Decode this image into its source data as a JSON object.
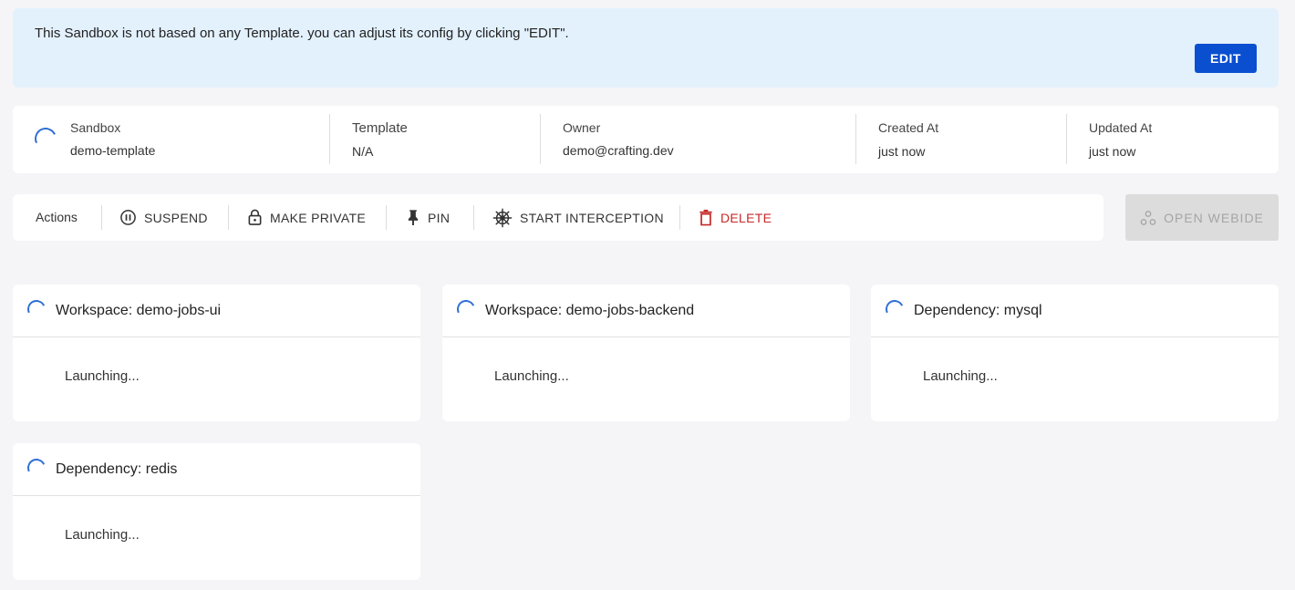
{
  "banner": {
    "message": "This Sandbox is not based on any Template. you can adjust its config by clicking \"EDIT\".",
    "edit_label": "EDIT"
  },
  "info": {
    "sandbox_label": "Sandbox",
    "sandbox_value": "demo-template",
    "template_label": "Template",
    "template_value": "N/A",
    "owner_label": "Owner",
    "owner_value": "demo@crafting.dev",
    "created_label": "Created At",
    "created_value": "just now",
    "updated_label": "Updated At",
    "updated_value": "just now"
  },
  "actions": {
    "label": "Actions",
    "suspend": "SUSPEND",
    "make_private": "MAKE PRIVATE",
    "pin": "PIN",
    "start_interception": "START INTERCEPTION",
    "delete": "DELETE",
    "open_webide": "OPEN WEBIDE"
  },
  "components": [
    {
      "title": "Workspace: demo-jobs-ui",
      "status": "Launching..."
    },
    {
      "title": "Workspace: demo-jobs-backend",
      "status": "Launching..."
    },
    {
      "title": "Dependency: mysql",
      "status": "Launching..."
    },
    {
      "title": "Dependency: redis",
      "status": "Launching..."
    }
  ],
  "colors": {
    "accent": "#0b4fd1",
    "banner_bg": "#e3f1fd",
    "danger": "#c62828",
    "spinner": "#2f6fd6"
  },
  "icons": {
    "suspend": "pause-circle-icon",
    "make_private": "lock-icon",
    "pin": "pin-icon",
    "start_interception": "helm-icon",
    "delete": "trash-icon",
    "open_webide": "nodes-icon"
  }
}
